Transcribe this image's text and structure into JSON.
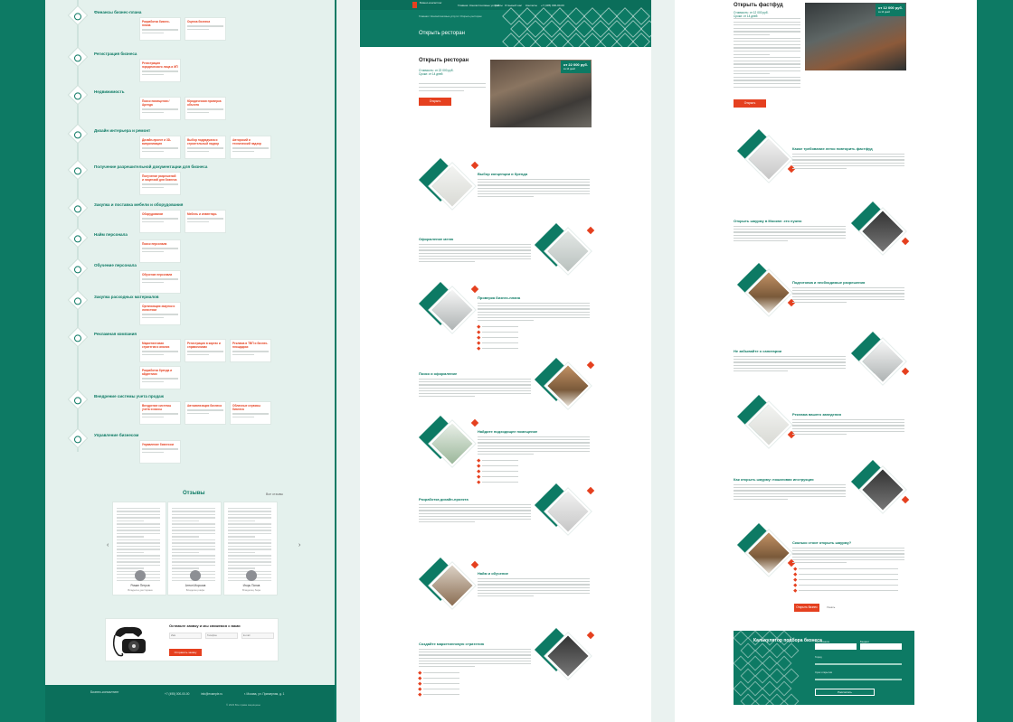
{
  "panel1": {
    "timeline": [
      {
        "title": "Финансы бизнес-плана",
        "cards": [
          "Разработка бизнес-плана",
          "Оценка бизнеса"
        ]
      },
      {
        "title": "Регистрация бизнеса",
        "cards": [
          "Регистрация юридического лица и ИП"
        ]
      },
      {
        "title": "Недвижимость",
        "cards": [
          "Поиск помещения / Аренда",
          "Юридическая проверка объекта"
        ]
      },
      {
        "title": "Дизайн интерьера и ремонт",
        "cards": [
          "Дизайн-проект и 3D-визуализация",
          "Выбор подрядчика и строительный надзор",
          "Авторский и технический надзор"
        ]
      },
      {
        "title": "Получение разрешительной документации для бизнеса",
        "cards": [
          "Получение разрешений и лицензий для бизнеса"
        ]
      },
      {
        "title": "Закупка и поставка мебели и оборудования",
        "cards": [
          "Оборудование",
          "Мебель и инвентарь"
        ]
      },
      {
        "title": "Найм персонала",
        "cards": [
          "Поиск персонала"
        ]
      },
      {
        "title": "Обучение персонала",
        "cards": [
          "Обучение персонала"
        ]
      },
      {
        "title": "Закупка расходных материалов",
        "cards": [
          "Организация закупок и логистики"
        ]
      },
      {
        "title": "Рекламная компания",
        "cards": [
          "Маркетинговая стратегия и анализ",
          "Регистрация в картах и справочниках",
          "Реклама в ТВП и бизнес-площадках",
          "Разработка бренда и айдентики"
        ]
      },
      {
        "title": "Внедрение системы учета продаж",
        "cards": [
          "Внедрение системы учета и кассы",
          "Автоматизация бизнеса",
          "Облачные сервисы бизнеса"
        ]
      },
      {
        "title": "Управление бизнесом",
        "cards": [
          "Управление бизнесом"
        ]
      }
    ],
    "reviews": {
      "title": "Отзывы",
      "all_link": "Все отзывы",
      "items": [
        {
          "name": "Роман Петров",
          "role": "Владелец ресторана"
        },
        {
          "name": "Антон Морозов",
          "role": "Владелец кафе"
        },
        {
          "name": "Игорь Попов",
          "role": "Владелец бара"
        }
      ]
    },
    "call": {
      "title": "Оставьте заявку и мы свяжемся с вами",
      "name_placeholder": "Имя",
      "phone_placeholder": "Телефон",
      "email_placeholder": "E-mail",
      "button": "Отправить заявку"
    },
    "footer": {
      "logo": "Бизнес-консалтинг",
      "phone": "+7 (495) 000-00-00",
      "email": "info@example.ru",
      "address": "г. Москва, ул. Примерная, д. 1",
      "copyright": "© 2023 Все права защищены"
    }
  },
  "panel2": {
    "logo": "Бизнес-консалтинг",
    "nav": [
      "Главная",
      "Консалтинговые услуги",
      "Кейсы",
      "Отзывы",
      "О нас",
      "Контакты",
      "+7 (495) 000-00-00"
    ],
    "crumbs": "Главная / Консалтинговые услуги / Открыть ресторан",
    "title": "Открыть ресторан",
    "subtitle": "Открыть ресторан",
    "price_line_1": "Стоимость: от 22 000 руб.",
    "price_line_2": "Сроки: от 14 дней",
    "button": "Открыть",
    "price_tag": "от 22 000 руб.",
    "price_tag_note": "за 14 дней",
    "sections": [
      "Выбор концепции и бренда",
      "Оформление меню",
      "Проверка бизнес-плана",
      "Поиск и оформление",
      "Найдите подходящее помещение",
      "Разработка дизайн-проекта",
      "Найм и обучение",
      "Создайте маркетинговую стратегию"
    ],
    "section_positions": []
  },
  "panel3": {
    "title": "Открыть фастфуд",
    "price_line_1": "Стоимость: от 12 000 руб.",
    "price_line_2": "Сроки: от 14 дней",
    "button": "Открыть",
    "price_tag": "от 12 000 руб.",
    "price_tag_note": "за 14 дней",
    "sections": [
      "Какое требование легко повторить фастфуд",
      "Открыть шаурму в Москве: это нужно",
      "Подготовка и необходимые разрешения",
      "Не забывайте о санитарии",
      "Реклама вашего заведения",
      "Как открыть шаурму: пошаговая инструкция",
      "Сколько стоит открыть шаурму?"
    ],
    "cta_button": "Открыть бизнес",
    "cta_secondary": "Узнать",
    "calculator": {
      "title": "Калькулятор подбора бизнеса",
      "label_1": "Тип бизнеса",
      "label_2": "Бюджет",
      "label_3": "Город",
      "label_4": "Срок открытия",
      "button": "Рассчитать"
    }
  }
}
